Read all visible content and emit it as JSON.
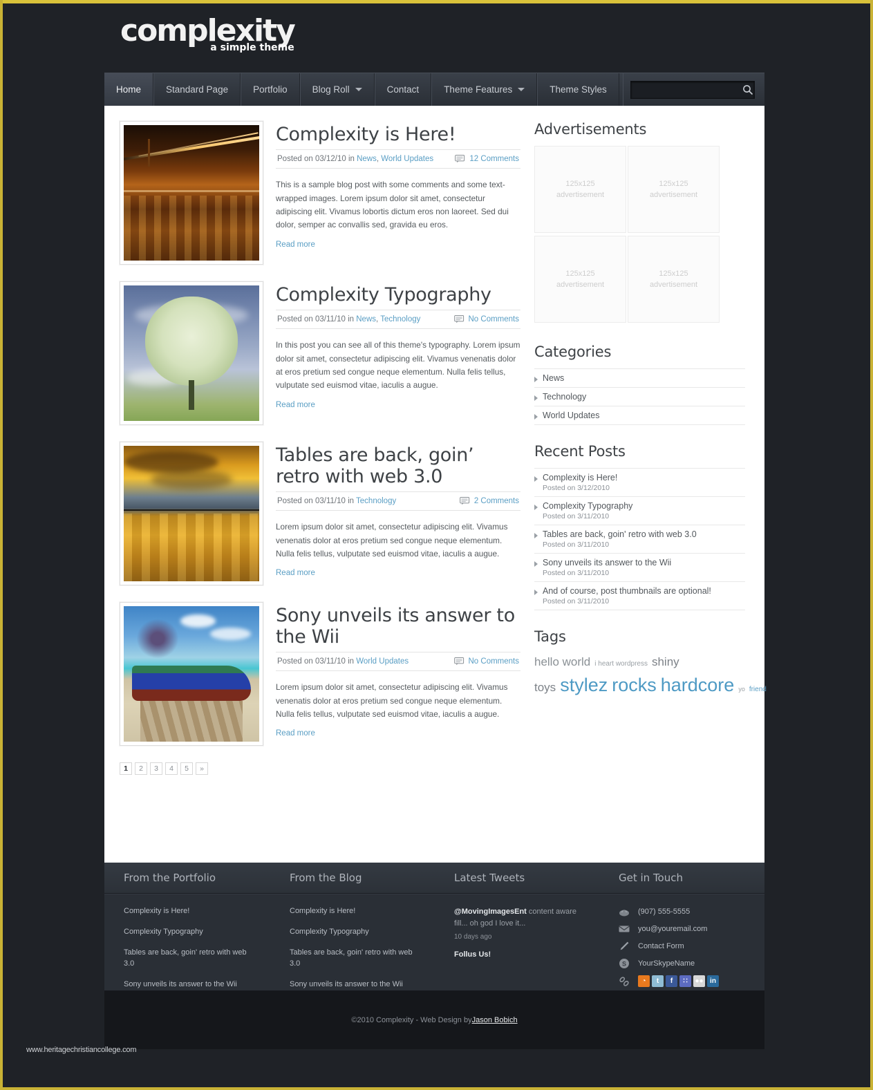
{
  "site": {
    "logo_main": "complexity",
    "logo_sub": "a simple theme"
  },
  "nav": {
    "items": [
      {
        "label": "Home",
        "active": true,
        "caret": false
      },
      {
        "label": "Standard Page",
        "active": false,
        "caret": false
      },
      {
        "label": "Portfolio",
        "active": false,
        "caret": false
      },
      {
        "label": "Blog Roll",
        "active": false,
        "caret": true
      },
      {
        "label": "Contact",
        "active": false,
        "caret": false
      },
      {
        "label": "Theme Features",
        "active": false,
        "caret": true
      },
      {
        "label": "Theme Styles",
        "active": false,
        "caret": false
      }
    ],
    "search_value": "",
    "search_placeholder": ""
  },
  "posts": [
    {
      "title": "Complexity is Here!",
      "posted_prefix": "Posted on 03/12/10 in ",
      "categories": [
        "News",
        "World Updates"
      ],
      "comments": "12 Comments",
      "excerpt": "This is a sample blog post with some comments and some text-wrapped images. Lorem ipsum dolor sit amet, consectetur adipiscing elit. Vivamus lobortis dictum eros non laoreet. Sed dui dolor, semper ac convallis sed, gravida eu eros.",
      "read_more": "Read more",
      "thumb_alt": "bridge-at-night-photo"
    },
    {
      "title": "Complexity Typography",
      "posted_prefix": "Posted on 03/11/10 in ",
      "categories": [
        "News",
        "Technology"
      ],
      "comments": "No Comments",
      "excerpt": "In this post you can see all of this theme's typography. Lorem ipsum dolor sit amet, consectetur adipiscing elit. Vivamus venenatis dolor at eros pretium sed congue neque elementum. Nulla felis tellus, vulputate sed euismod vitae, iaculis a augue.",
      "read_more": "Read more",
      "thumb_alt": "white-tree-photo"
    },
    {
      "title": "Tables are back, goin’ retro with web 3.0",
      "posted_prefix": "Posted on 03/11/10 in ",
      "categories": [
        "Technology"
      ],
      "comments": "2 Comments",
      "excerpt": "Lorem ipsum dolor sit amet, consectetur adipiscing elit. Vivamus venenatis dolor at eros pretium sed congue neque elementum. Nulla felis tellus, vulputate sed euismod vitae, iaculis a augue.",
      "read_more": "Read more",
      "thumb_alt": "golden-sunset-lake-photo"
    },
    {
      "title": "Sony unveils its answer to the Wii",
      "posted_prefix": "Posted on 03/11/10 in ",
      "categories": [
        "World Updates"
      ],
      "comments": "No Comments",
      "excerpt": "Lorem ipsum dolor sit amet, consectetur adipiscing elit. Vivamus venenatis dolor at eros pretium sed congue neque elementum. Nulla felis tellus, vulputate sed euismod vitae, iaculis a augue.",
      "read_more": "Read more",
      "thumb_alt": "blue-boat-beach-photo"
    }
  ],
  "pagination": {
    "pages": [
      "1",
      "2",
      "3",
      "4",
      "5",
      "»"
    ],
    "current": "1"
  },
  "sidebar": {
    "ads_title": "Advertisements",
    "ads": [
      {
        "size": "125x125",
        "caption": "advertisement"
      },
      {
        "size": "125x125",
        "caption": "advertisement"
      },
      {
        "size": "125x125",
        "caption": "advertisement"
      },
      {
        "size": "125x125",
        "caption": "advertisement"
      }
    ],
    "categories_title": "Categories",
    "categories": [
      "News",
      "Technology",
      "World Updates"
    ],
    "recent_title": "Recent Posts",
    "recent": [
      {
        "title": "Complexity is Here!",
        "date": "Posted on 3/12/2010"
      },
      {
        "title": "Complexity Typography",
        "date": "Posted on 3/11/2010"
      },
      {
        "title": "Tables are back, goin' retro with web 3.0",
        "date": "Posted on 3/11/2010"
      },
      {
        "title": "Sony unveils its answer to the Wii",
        "date": "Posted on 3/11/2010"
      },
      {
        "title": "And of course, post thumbnails are optional!",
        "date": "Posted on 3/11/2010"
      }
    ],
    "tags_title": "Tags",
    "tags": [
      {
        "label": "hello world",
        "size": 17,
        "color": "#8a9095"
      },
      {
        "label": "i heart wordpress",
        "size": 10,
        "color": "#9aa0a5"
      },
      {
        "label": "shiny toys",
        "size": 17,
        "color": "#7d8288"
      },
      {
        "label": "stylez",
        "size": 27,
        "color": "#4e9ac4"
      },
      {
        "label": "rocks",
        "size": 27,
        "color": "#4e9ac4"
      },
      {
        "label": "hardcore",
        "size": 27,
        "color": "#4e9ac4"
      },
      {
        "label": "yo",
        "size": 9,
        "color": "#9aa0a5"
      },
      {
        "label": "friend",
        "size": 10,
        "color": "#5a9ec4"
      }
    ]
  },
  "footer": {
    "columns": [
      {
        "title": "From the Portfolio",
        "links": [
          "Complexity is Here!",
          "Complexity Typography",
          "Tables are back, goin' retro with web 3.0",
          "Sony unveils its answer to the Wii"
        ]
      },
      {
        "title": "From the Blog",
        "links": [
          "Complexity is Here!",
          "Complexity Typography",
          "Tables are back, goin' retro with web 3.0",
          "Sony unveils its answer to the Wii"
        ]
      }
    ],
    "tweets_title": "Latest Tweets",
    "tweet_handle": "@MovingImagesEnt",
    "tweet_text": " content aware fill... oh god I love it...",
    "tweet_time": "10 days ago",
    "follow_label": "Follus Us!",
    "contact_title": "Get in Touch",
    "contact": [
      {
        "icon": "phone-icon",
        "value": "(907) 555-5555"
      },
      {
        "icon": "envelope-icon",
        "value": "you@youremail.com"
      },
      {
        "icon": "pencil-icon",
        "value": "Contact Form"
      },
      {
        "icon": "skype-icon",
        "value": "YourSkypeName"
      }
    ],
    "social": [
      {
        "name": "rss-icon",
        "glyph": "◔",
        "color": "#e8791e"
      },
      {
        "name": "twitter-icon",
        "glyph": "t",
        "color": "#8fbcd4"
      },
      {
        "name": "facebook-icon",
        "glyph": "f",
        "color": "#3b5998"
      },
      {
        "name": "friendfeed-icon",
        "glyph": "∷",
        "color": "#5c6bc0"
      },
      {
        "name": "flickr-icon",
        "glyph": "●●",
        "color": "#d8d8d8"
      },
      {
        "name": "linkedin-icon",
        "glyph": "in",
        "color": "#2a6a9c"
      }
    ],
    "copyright_pre": "©2010 Complexity - Web Design by ",
    "copyright_author": "Jason Bobich"
  },
  "watermark": "www.heritagechristiancollege.com"
}
